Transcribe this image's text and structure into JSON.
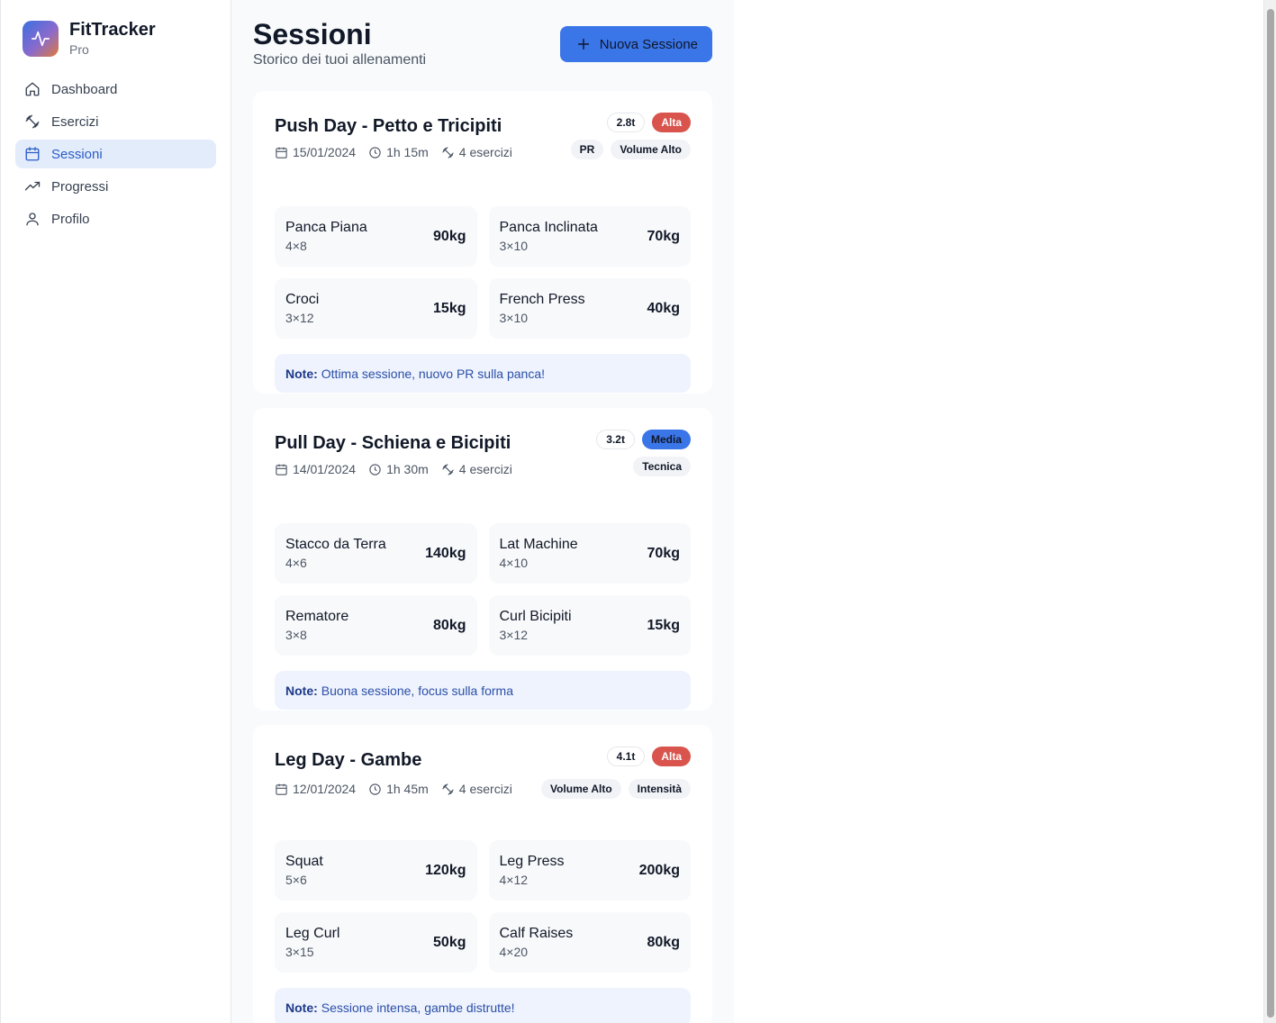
{
  "brand": {
    "name": "FitTracker",
    "subtitle": "Pro"
  },
  "nav": [
    {
      "label": "Dashboard",
      "icon": "home-icon",
      "active": false
    },
    {
      "label": "Esercizi",
      "icon": "dumbbell-icon",
      "active": false
    },
    {
      "label": "Sessioni",
      "icon": "calendar-icon",
      "active": true
    },
    {
      "label": "Progressi",
      "icon": "trending-up-icon",
      "active": false
    },
    {
      "label": "Profilo",
      "icon": "user-icon",
      "active": false
    }
  ],
  "header": {
    "title": "Sessioni",
    "subtitle": "Storico dei tuoi allenamenti",
    "new_button": "Nuova Sessione"
  },
  "colors": {
    "accent": "#3b76e8",
    "high": "#d9544d",
    "medium": "#3b76e8"
  },
  "sessions": [
    {
      "title": "Push Day - Petto e Tricipiti",
      "date": "15/01/2024",
      "duration": "1h 15m",
      "count": "4 esercizi",
      "volume": "2.8t",
      "intensity": "Alta",
      "tags": [
        "PR",
        "Volume Alto"
      ],
      "exercises": [
        {
          "name": "Panca Piana",
          "sets": "4×8",
          "weight": "90kg"
        },
        {
          "name": "Panca Inclinata",
          "sets": "3×10",
          "weight": "70kg"
        },
        {
          "name": "Croci",
          "sets": "3×12",
          "weight": "15kg"
        },
        {
          "name": "French Press",
          "sets": "3×10",
          "weight": "40kg"
        }
      ],
      "note_label": "Note:",
      "note": "Ottima sessione, nuovo PR sulla panca!"
    },
    {
      "title": "Pull Day - Schiena e Bicipiti",
      "date": "14/01/2024",
      "duration": "1h 30m",
      "count": "4 esercizi",
      "volume": "3.2t",
      "intensity": "Media",
      "tags": [
        "Tecnica"
      ],
      "exercises": [
        {
          "name": "Stacco da Terra",
          "sets": "4×6",
          "weight": "140kg"
        },
        {
          "name": "Lat Machine",
          "sets": "4×10",
          "weight": "70kg"
        },
        {
          "name": "Rematore",
          "sets": "3×8",
          "weight": "80kg"
        },
        {
          "name": "Curl Bicipiti",
          "sets": "3×12",
          "weight": "15kg"
        }
      ],
      "note_label": "Note:",
      "note": "Buona sessione, focus sulla forma"
    },
    {
      "title": "Leg Day - Gambe",
      "date": "12/01/2024",
      "duration": "1h 45m",
      "count": "4 esercizi",
      "volume": "4.1t",
      "intensity": "Alta",
      "tags": [
        "Volume Alto",
        "Intensità"
      ],
      "exercises": [
        {
          "name": "Squat",
          "sets": "5×6",
          "weight": "120kg"
        },
        {
          "name": "Leg Press",
          "sets": "4×12",
          "weight": "200kg"
        },
        {
          "name": "Leg Curl",
          "sets": "3×15",
          "weight": "50kg"
        },
        {
          "name": "Calf Raises",
          "sets": "4×20",
          "weight": "80kg"
        }
      ],
      "note_label": "Note:",
      "note": "Sessione intensa, gambe distrutte!"
    }
  ]
}
